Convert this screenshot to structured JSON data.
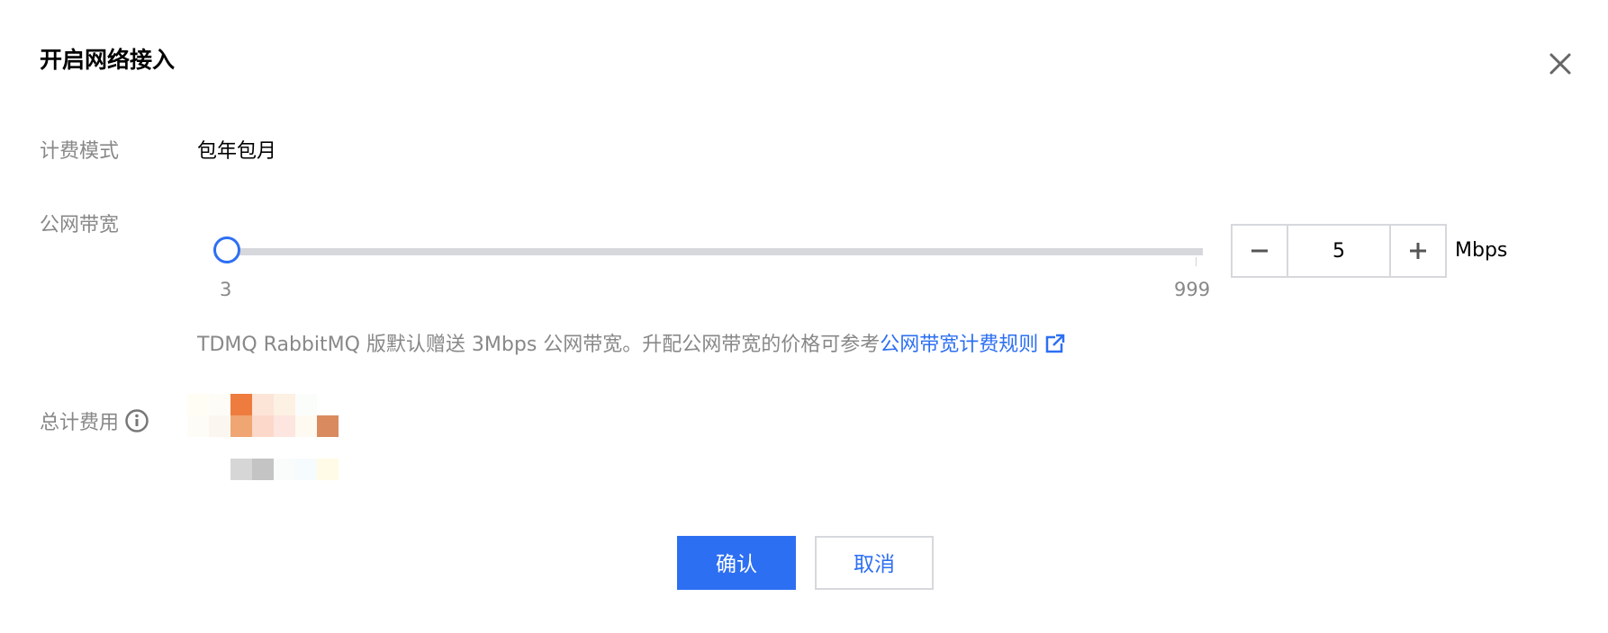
{
  "dialog": {
    "title": "开启网络接入",
    "close_icon": "close-icon"
  },
  "billing": {
    "label": "计费模式",
    "value": "包年包月"
  },
  "bandwidth": {
    "label": "公网带宽",
    "min_label": "3",
    "max_label": "999",
    "min": 3,
    "max": 999,
    "value": 5,
    "value_text": "5",
    "unit": "Mbps",
    "minus_icon": "minus-icon",
    "plus_icon": "plus-icon"
  },
  "note": {
    "text": "TDMQ RabbitMQ 版默认赠送 3Mbps 公网带宽。升配公网带宽的价格可参考",
    "link_text": "公网带宽计费规则",
    "link_icon": "external-link-icon"
  },
  "total_fee": {
    "label": "总计费用",
    "info_icon": "info-icon"
  },
  "actions": {
    "confirm_label": "确认",
    "cancel_label": "取消"
  },
  "colors": {
    "accent": "#2d6ff2",
    "label_gray": "#888888",
    "border": "#d6d8dc"
  }
}
